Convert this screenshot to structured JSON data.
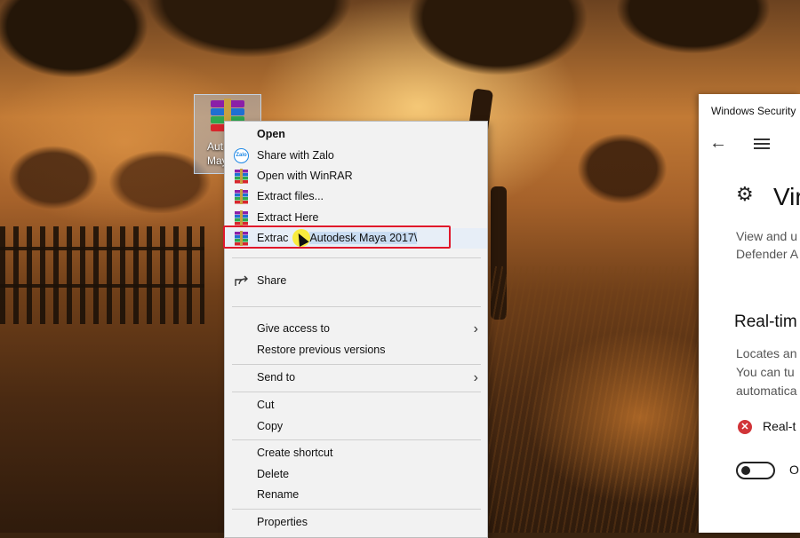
{
  "desktop": {
    "icon_label": "Autodesk Maya 2017",
    "icon_label_visible": "Aut\nMay"
  },
  "context_menu": {
    "items": [
      {
        "label": "Open",
        "bold": true,
        "icon": "none"
      },
      {
        "label": "Share with Zalo",
        "icon": "zalo-icon"
      },
      {
        "label": "Open with WinRAR",
        "icon": "winrar-icon"
      },
      {
        "label": "Extract files...",
        "icon": "winrar-icon"
      },
      {
        "label": "Extract Here",
        "icon": "winrar-icon"
      },
      {
        "label_prefix": "Extrac",
        "label_selected": "Autodesk Maya 2017\\",
        "icon": "winrar-icon",
        "highlighted": true
      },
      {
        "label": "Share",
        "icon": "share-icon"
      },
      {
        "label": "Give access to",
        "submenu": true
      },
      {
        "label": "Restore previous versions"
      },
      {
        "label": "Send to",
        "submenu": true
      },
      {
        "label": "Cut"
      },
      {
        "label": "Copy"
      },
      {
        "label": "Create shortcut"
      },
      {
        "label": "Delete"
      },
      {
        "label": "Rename"
      },
      {
        "label": "Properties"
      }
    ],
    "submenu_arrow": "›",
    "zalo_text": "Zalo"
  },
  "windows_security": {
    "title": "Windows Security",
    "heading": "Vir",
    "subtitle": "View and u\nDefender A",
    "section_title": "Real-tim",
    "section_desc": "Locates an\nYou can tu\nautomatica",
    "status_label": "Real-t",
    "toggle_label": "O",
    "back_glyph": "←",
    "gear_glyph": "⚙",
    "status_glyph": "✕"
  },
  "colors": {
    "highlight_border": "#e0172b",
    "menu_bg": "#f2f2f2",
    "cursor_highlight": "#ffeb00",
    "ws_status_red": "#d13438"
  }
}
